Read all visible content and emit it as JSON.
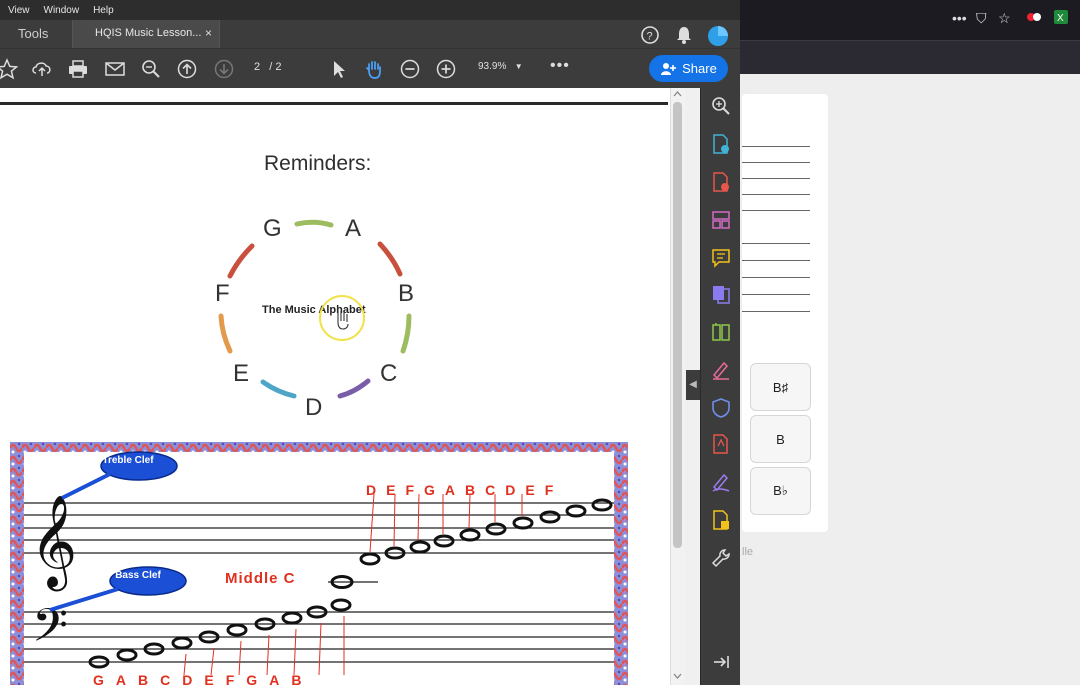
{
  "menubar": {
    "items": [
      "View",
      "Window",
      "Help"
    ]
  },
  "tabs": {
    "tools_label": "Tools",
    "document_title": "HQIS Music Lesson...",
    "close_glyph": "×"
  },
  "toolbar": {
    "page_current": "2",
    "page_total": "/ 2",
    "zoom": "93.9%",
    "more_glyph": "•••",
    "share_label": "Share"
  },
  "document": {
    "heading": "Reminders:",
    "circle_label": "The Music Alphabet",
    "alphabet": [
      "G",
      "A",
      "B",
      "C",
      "D",
      "E",
      "F"
    ],
    "treble_label": "Treble Clef",
    "bass_label": "Bass Clef",
    "middle_c_label": "Middle C",
    "treble_notes": [
      "D",
      "E",
      "F",
      "G",
      "A",
      "B",
      "C",
      "D",
      "E",
      "F"
    ],
    "bass_notes": [
      "G",
      "A",
      "B",
      "C",
      "D",
      "E",
      "F",
      "G",
      "A",
      "B"
    ]
  },
  "browser": {
    "note_buttons": [
      "B♯",
      "B",
      "B♭"
    ],
    "faint_text": "lle"
  },
  "colors": {
    "share_blue": "#1473e6",
    "acrobat_dark": "#3c3c3c",
    "note_red": "#e0301e",
    "clef_blue": "#1b4fd6"
  }
}
